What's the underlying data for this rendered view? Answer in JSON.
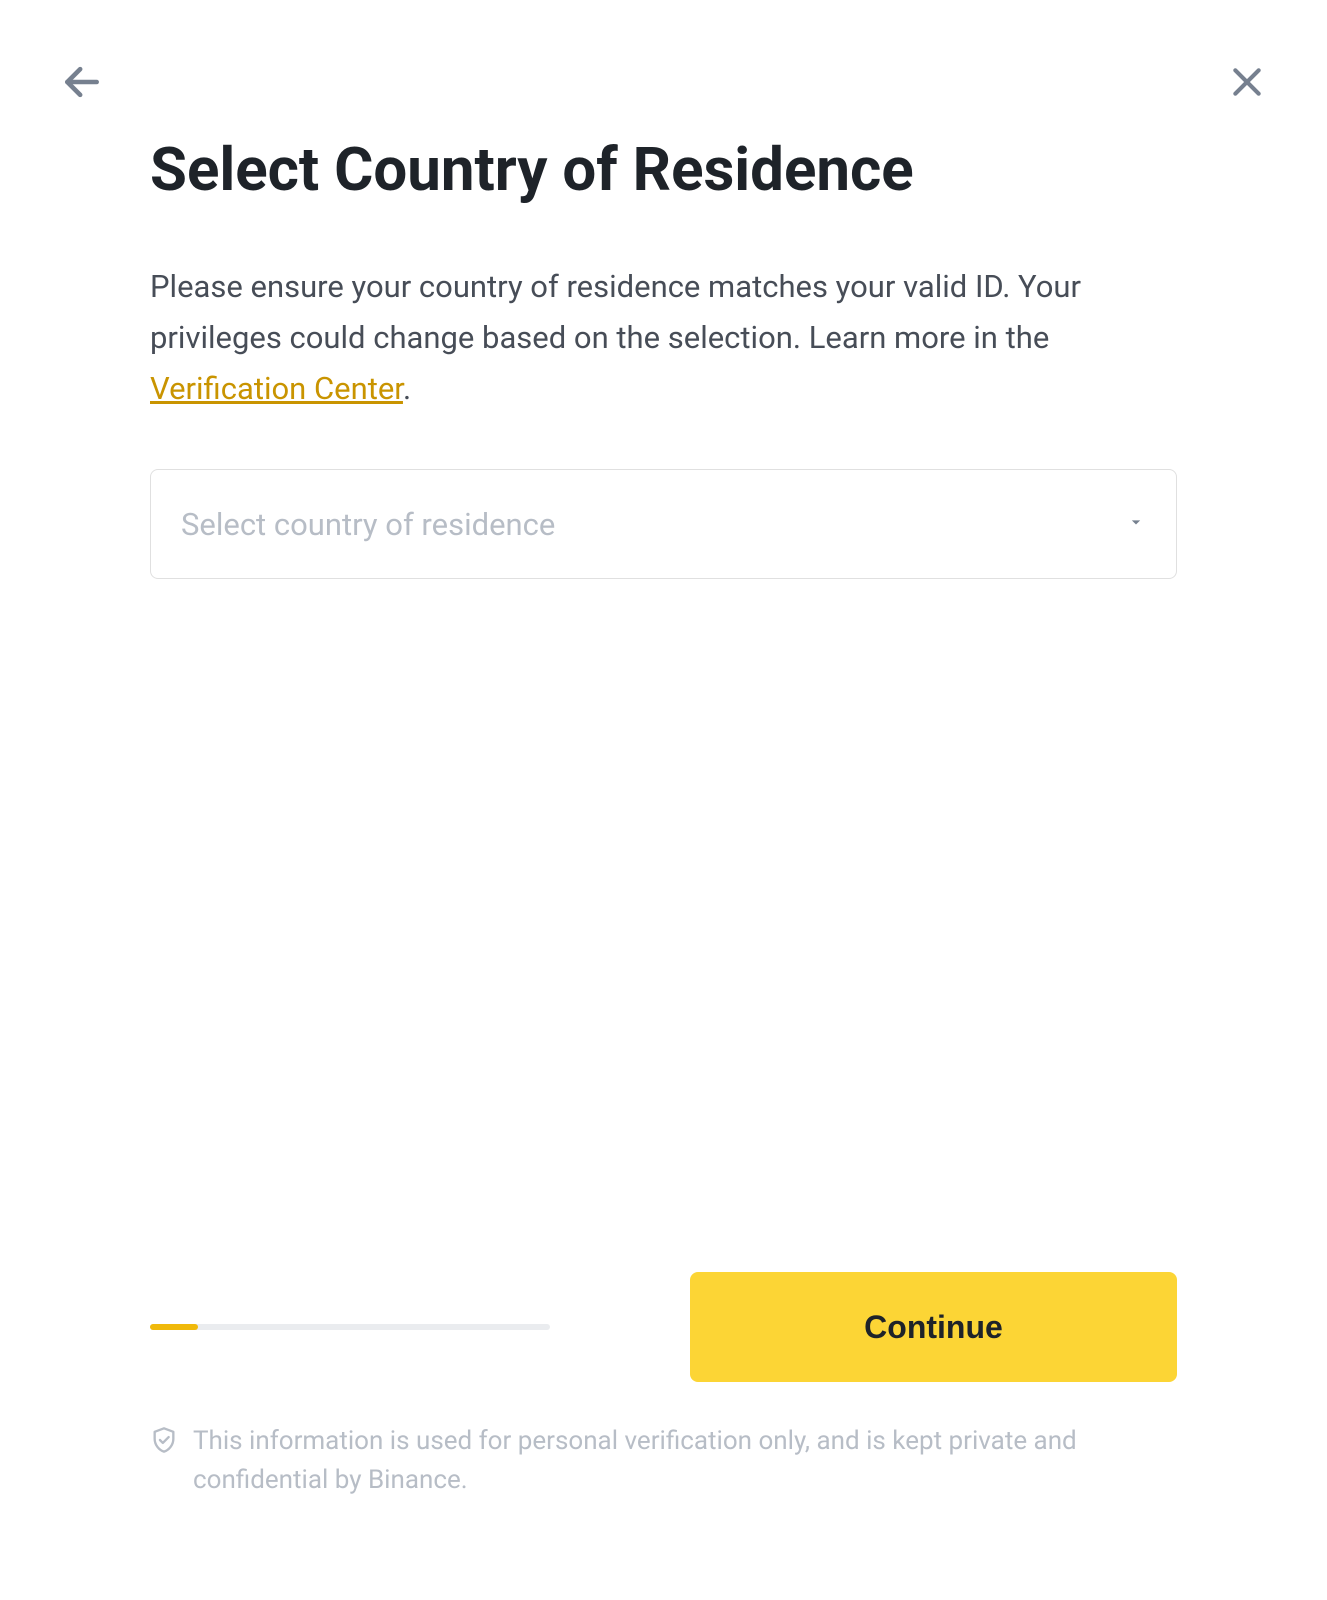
{
  "header": {
    "title": "Select Country of Residence"
  },
  "description": {
    "text_before": "Please ensure your country of residence matches your valid ID. Your privileges could change based on the selection. Learn more in the ",
    "link_text": "Verification Center",
    "text_after": "."
  },
  "select": {
    "placeholder": "Select country of residence"
  },
  "progress": {
    "percent": 12
  },
  "actions": {
    "continue_label": "Continue"
  },
  "disclaimer": {
    "text": "This information is used for personal verification only, and is kept private and confidential by Binance."
  }
}
